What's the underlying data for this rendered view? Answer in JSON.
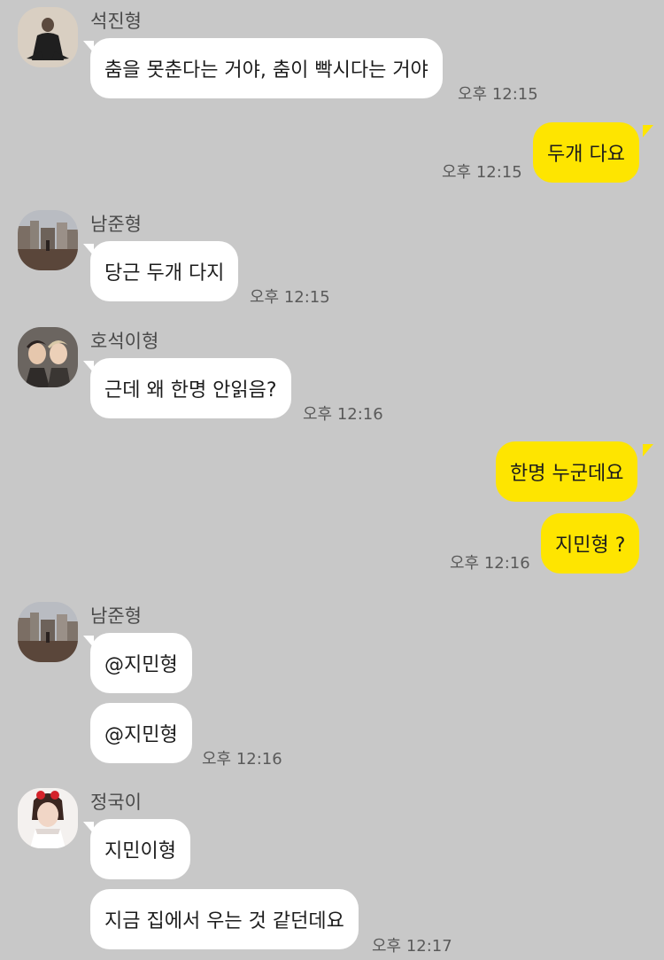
{
  "messages": {
    "m1": {
      "sender": "석진형",
      "text": "춤을 못춘다는 거야, 춤이 빡시다는 거야",
      "time": "오후 12:15"
    },
    "m2": {
      "text": "두개 다요",
      "time": "오후 12:15"
    },
    "m3": {
      "sender": "남준형",
      "text": "당근 두개 다지",
      "time": "오후 12:15"
    },
    "m4": {
      "sender": "호석이형",
      "text": "근데 왜 한명 안읽음?",
      "time": "오후 12:16"
    },
    "m5": {
      "text": "한명 누군데요"
    },
    "m6": {
      "text": "지민형 ?",
      "time": "오후 12:16"
    },
    "m7": {
      "sender": "남준형",
      "text": "@지민형"
    },
    "m8": {
      "text": "@지민형",
      "time": "오후 12:16"
    },
    "m9": {
      "sender": "정국이",
      "text": "지민이형"
    },
    "m10": {
      "text": "지금 집에서 우는 것 같던데요",
      "time": "오후 12:17"
    }
  },
  "colors": {
    "background": "#c8c8c8",
    "incoming_bubble": "#ffffff",
    "outgoing_bubble": "#fee500"
  }
}
